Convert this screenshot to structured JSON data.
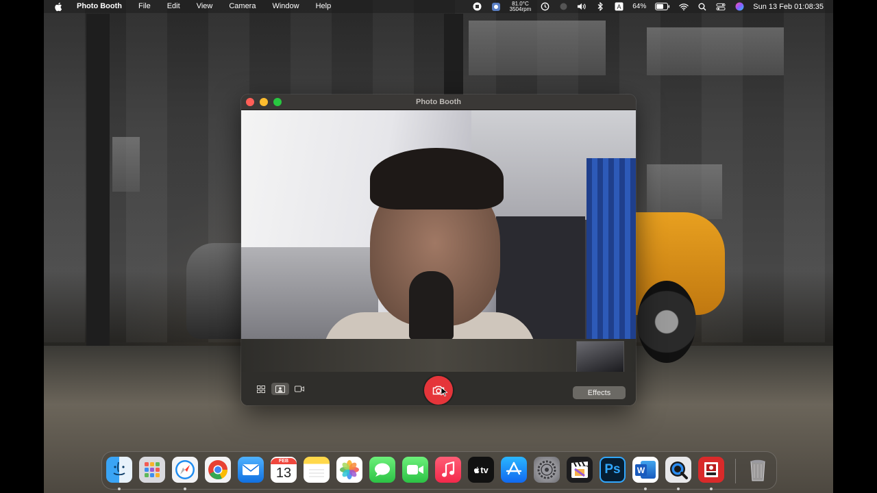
{
  "menubar": {
    "app_name": "Photo Booth",
    "menus": [
      "File",
      "Edit",
      "View",
      "Camera",
      "Window",
      "Help"
    ],
    "temperature": "81.0°C",
    "fan_speed": "3504rpm",
    "battery_percent": "64%",
    "datetime": "Sun 13 Feb  01:08:35"
  },
  "window": {
    "title": "Photo Booth",
    "effects_label": "Effects"
  },
  "dock": {
    "calendar_month": "FEB",
    "calendar_day": "13",
    "tv_label": "tv",
    "ps_label": "Ps",
    "word_label": "W",
    "apps": [
      "finder",
      "launchpad",
      "safari",
      "chrome",
      "mail",
      "calendar",
      "notes",
      "photos",
      "messages",
      "facetime",
      "music",
      "apple-tv",
      "app-store",
      "system-preferences",
      "final-cut-pro",
      "photoshop",
      "word",
      "quicktime",
      "photo-booth",
      "trash"
    ]
  },
  "colors": {
    "shutter": "#e5353a",
    "close": "#ff5f57",
    "minimize": "#febc2e",
    "zoom": "#28c840"
  }
}
